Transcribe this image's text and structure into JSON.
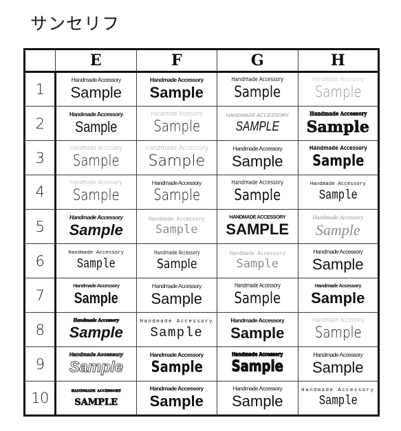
{
  "page": {
    "title": "サンセリフ",
    "background_color": "#ffffff",
    "text_color": "#111111",
    "frame_color": "#111111",
    "grid_color": "#3a3a3a"
  },
  "table": {
    "column_headers": [
      "",
      "E",
      "F",
      "G",
      "H"
    ],
    "row_labels": [
      "1",
      "2",
      "3",
      "4",
      "5",
      "6",
      "7",
      "8",
      "9",
      "10"
    ],
    "sample_small_text": "Handmade Accessory",
    "sample_large_text": "Sample",
    "cells": [
      [
        {
          "small": "Handmade Accessory",
          "large": "Sample"
        },
        {
          "small": "Handmade Accessory",
          "large": "Sample"
        },
        {
          "small": "Handmade Accessory",
          "large": "Sample"
        },
        {
          "small": "Handmade Accessory",
          "large": "Sample"
        }
      ],
      [
        {
          "small": "Handmade Accessory",
          "large": "Sample"
        },
        {
          "small": "Handmade Accessory",
          "large": "Sample"
        },
        {
          "small": "HANDMADE ACCESSORY",
          "large": "SAMPLE"
        },
        {
          "small": "Handmade Accessory",
          "large": "Sample"
        }
      ],
      [
        {
          "small": "Handmade Accessory",
          "large": "Sample"
        },
        {
          "small": "Handmade Accessory",
          "large": "Sample"
        },
        {
          "small": "Handmade Accessory",
          "large": "Sample"
        },
        {
          "small": "Handmade Accessory",
          "large": "Sample"
        }
      ],
      [
        {
          "small": "Handmade Accessory",
          "large": "Sample"
        },
        {
          "small": "Handmade Accessory",
          "large": "Sample"
        },
        {
          "small": "Handmade Accessory",
          "large": "Sample"
        },
        {
          "small": "Handmade Accessory",
          "large": "Sample"
        }
      ],
      [
        {
          "small": "Handmade Accessory",
          "large": "Sample"
        },
        {
          "small": "Handmade Accessory",
          "large": "Sample"
        },
        {
          "small": "HANDMADE ACCESSORY",
          "large": "SAMPLE"
        },
        {
          "small": "Handmade Accessory",
          "large": "Sample"
        }
      ],
      [
        {
          "small": "Handmade Accessory",
          "large": "Sample"
        },
        {
          "small": "Handmade Accessory",
          "large": "Sample"
        },
        {
          "small": "Handmade Accessory",
          "large": "Sample"
        },
        {
          "small": "Handmade Accessory",
          "large": "Sample"
        }
      ],
      [
        {
          "small": "Handmade Accessory",
          "large": "Sample"
        },
        {
          "small": "Handmade Accessory",
          "large": "Sample"
        },
        {
          "small": "Handmade Accessory",
          "large": "Sample"
        },
        {
          "small": "Handmade Accessory",
          "large": "Sample"
        }
      ],
      [
        {
          "small": "Handmade Accessory",
          "large": "Sample"
        },
        {
          "small": "Handmade Accessory",
          "large": "Sample"
        },
        {
          "small": "Handmade Accessory",
          "large": "Sample"
        },
        {
          "small": "Handmade Accessory",
          "large": "Sample"
        }
      ],
      [
        {
          "small": "Handmade Accessory",
          "large": "Sample"
        },
        {
          "small": "Handmade Accessory",
          "large": "Sample"
        },
        {
          "small": "Handmade Accessory",
          "large": "Sample"
        },
        {
          "small": "Handmade Accessory",
          "large": "Sample"
        }
      ],
      [
        {
          "small": "HANDMADE ACCESSORY",
          "large": "SAMPLE"
        },
        {
          "small": "Handmade Accessory",
          "large": "Sample"
        },
        {
          "small": "Handmade Accessory",
          "large": "Sample"
        },
        {
          "small": "Handmade Accessory",
          "large": "Sample"
        }
      ]
    ]
  }
}
